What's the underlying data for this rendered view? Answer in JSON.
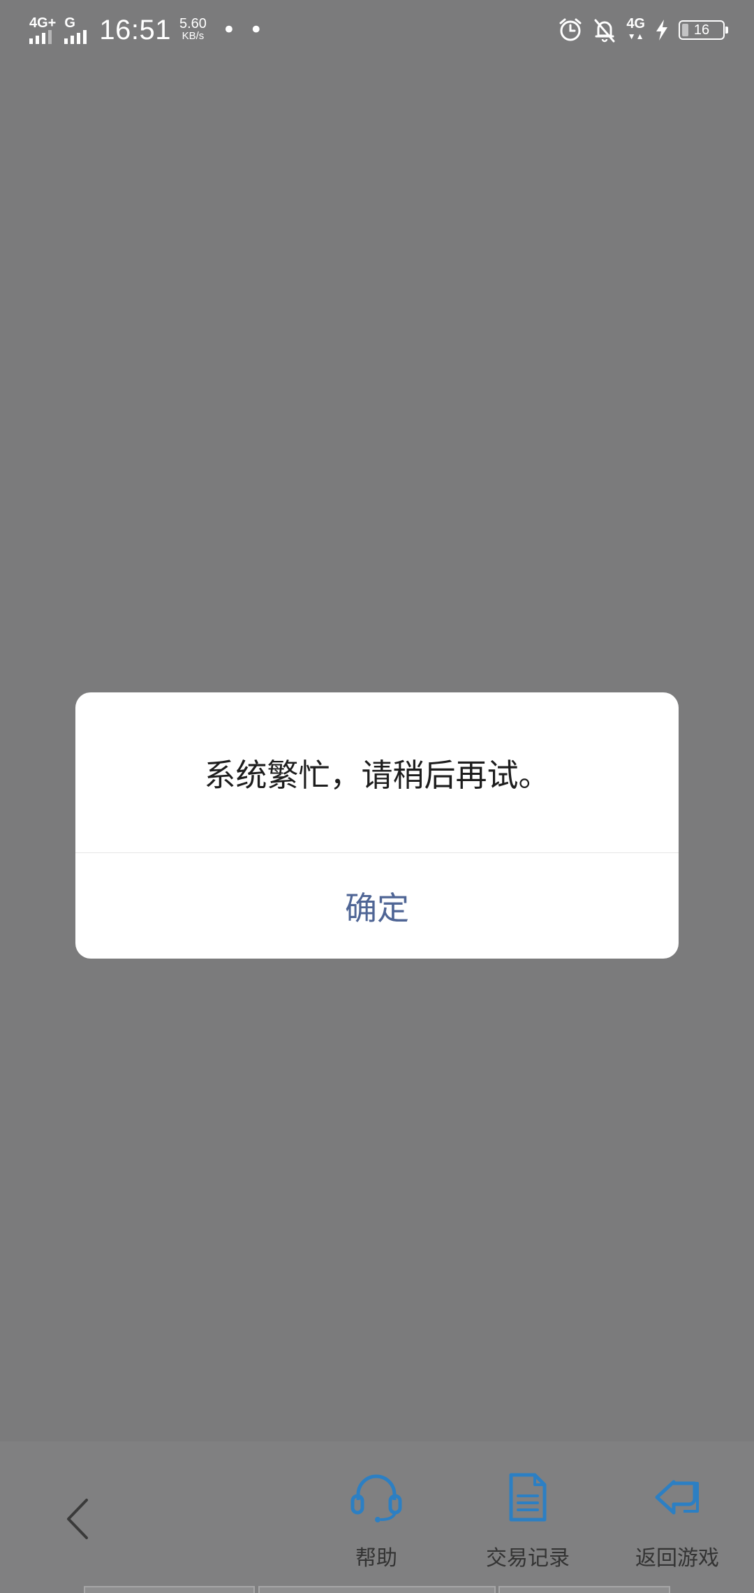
{
  "status_bar": {
    "sim1_label": "4G+",
    "sim2_label": "G",
    "time": "16:51",
    "speed_value": "5.60",
    "speed_unit": "KB/s",
    "more_dots": "• •",
    "network_right": "4G",
    "battery_level": "16"
  },
  "dialog": {
    "message": "系统繁忙，请稍后再试。",
    "confirm_label": "确定"
  },
  "toolbar": {
    "help_label": "帮助",
    "record_label": "交易记录",
    "return_label": "返回游戏"
  },
  "colors": {
    "overlay": "#7b7b7c",
    "toolbar_bg": "#808081",
    "icon_blue": "#2c7fc3",
    "confirm_text": "#4f6595"
  },
  "icons": {
    "back": "chevron-left-icon",
    "help": "headset-icon",
    "record": "document-icon",
    "return": "return-arrow-icon"
  }
}
